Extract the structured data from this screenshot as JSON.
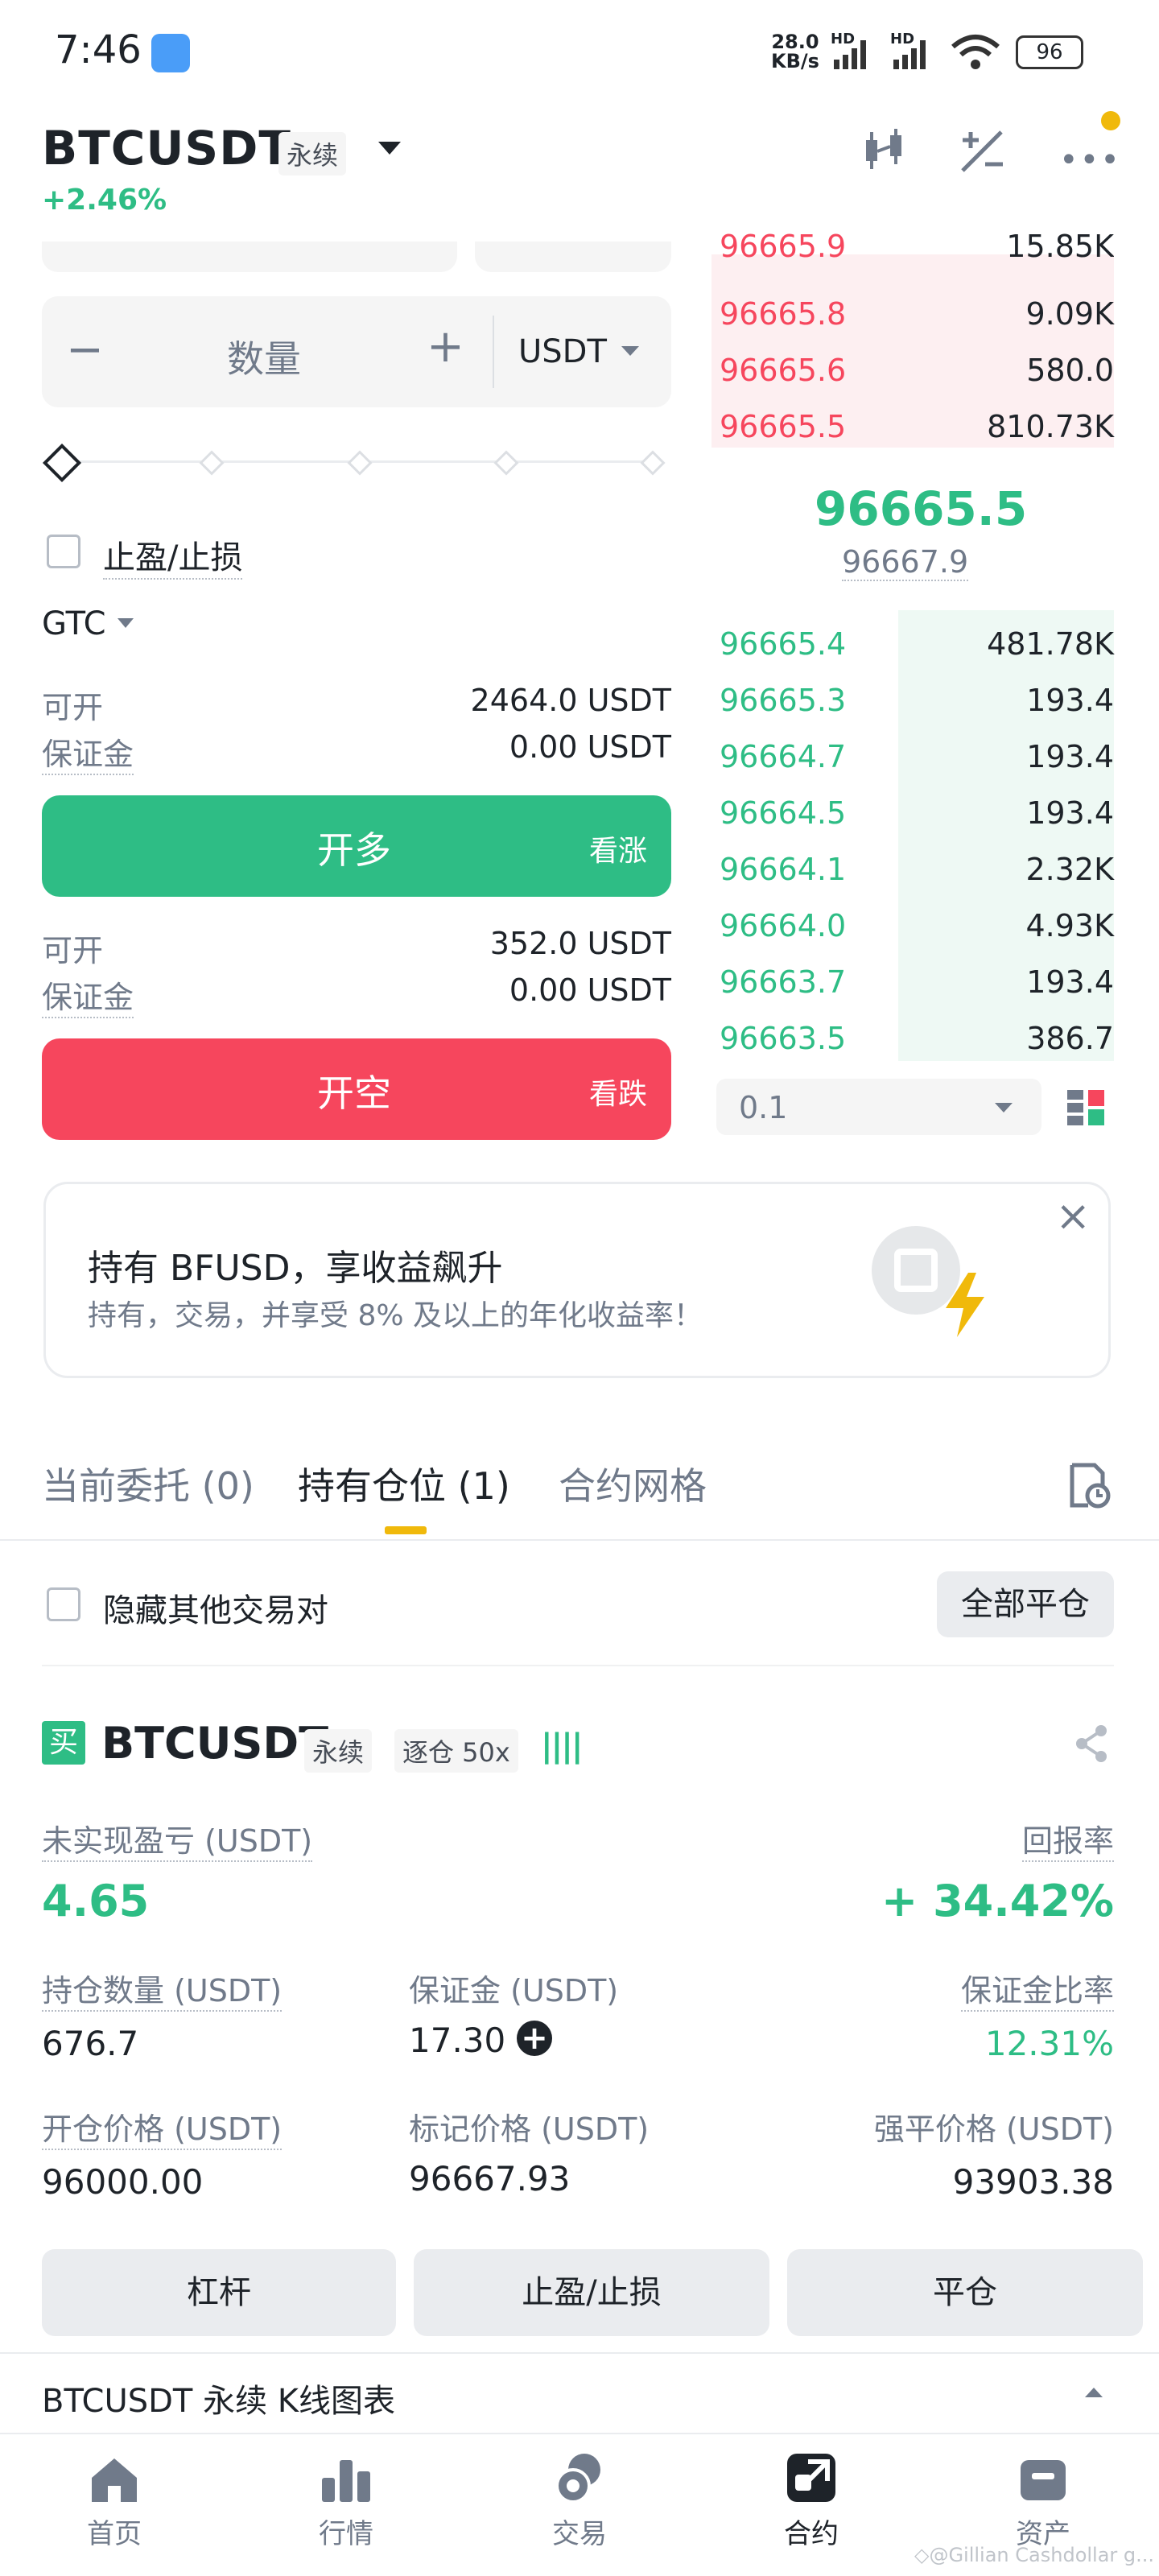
{
  "status_bar": {
    "time": "7:46",
    "net_speed_top": "28.0",
    "net_speed_bottom": "KB/s",
    "hd1": "HD",
    "hd2": "HD",
    "battery": "96"
  },
  "header": {
    "pair": "BTCUSDT",
    "contract_type": "永续",
    "change": "+2.46%"
  },
  "order_form": {
    "quantity_placeholder": "数量",
    "minus": "−",
    "plus": "+",
    "unit": "USDT",
    "tpsl_label": "止盈/止损",
    "time_in_force": "GTC",
    "long": {
      "available_label": "可开",
      "available_value": "2464.0 USDT",
      "margin_label": "保证金",
      "margin_value": "0.00 USDT",
      "button": "开多",
      "button_sub": "看涨"
    },
    "short": {
      "available_label": "可开",
      "available_value": "352.0 USDT",
      "margin_label": "保证金",
      "margin_value": "0.00 USDT",
      "button": "开空",
      "button_sub": "看跌"
    }
  },
  "orderbook": {
    "asks": [
      {
        "price": "96665.9",
        "qty": "15.85K"
      },
      {
        "price": "96665.8",
        "qty": "9.09K"
      },
      {
        "price": "96665.6",
        "qty": "580.0"
      },
      {
        "price": "96665.5",
        "qty": "810.73K"
      }
    ],
    "last_price": "96665.5",
    "mark_price": "96667.9",
    "bids": [
      {
        "price": "96665.4",
        "qty": "481.78K"
      },
      {
        "price": "96665.3",
        "qty": "193.4"
      },
      {
        "price": "96664.7",
        "qty": "193.4"
      },
      {
        "price": "96664.5",
        "qty": "193.4"
      },
      {
        "price": "96664.1",
        "qty": "2.32K"
      },
      {
        "price": "96664.0",
        "qty": "4.93K"
      },
      {
        "price": "96663.7",
        "qty": "193.4"
      },
      {
        "price": "96663.5",
        "qty": "386.7"
      }
    ],
    "precision": "0.1"
  },
  "banner": {
    "title": "持有 BFUSD，享收益飙升",
    "subtitle": "持有，交易，并享受 8% 及以上的年化收益率！"
  },
  "tabs": {
    "open_orders": "当前委托 (0)",
    "positions": "持有仓位 (1)",
    "grid": "合约网格"
  },
  "position_toolbar": {
    "hide_pairs": "隐藏其他交易对",
    "close_all": "全部平仓"
  },
  "position": {
    "side_badge": "买",
    "pair": "BTCUSDT",
    "type": "永续",
    "margin_mode": "逐仓 50x",
    "unrealized_label": "未实现盈亏 (USDT)",
    "unrealized_value": "4.65",
    "roe_label": "回报率",
    "roe_value": "+ 34.42%",
    "size_label": "持仓数量 (USDT)",
    "size_value": "676.7",
    "margin_label": "保证金 (USDT)",
    "margin_value": "17.30",
    "margin_ratio_label": "保证金比率",
    "margin_ratio_value": "12.31%",
    "entry_label": "开仓价格 (USDT)",
    "entry_value": "96000.00",
    "mark_label": "标记价格 (USDT)",
    "mark_value": "96667.93",
    "liq_label": "强平价格 (USDT)",
    "liq_value": "93903.38",
    "btn_leverage": "杠杆",
    "btn_tpsl": "止盈/止损",
    "btn_close": "平仓"
  },
  "chart_bar": {
    "label": "BTCUSDT 永续 K线图表"
  },
  "bottom_nav": [
    {
      "label": "首页",
      "icon": "home-icon"
    },
    {
      "label": "行情",
      "icon": "markets-icon"
    },
    {
      "label": "交易",
      "icon": "trade-icon"
    },
    {
      "label": "合约",
      "icon": "futures-icon"
    },
    {
      "label": "资产",
      "icon": "wallet-icon"
    }
  ],
  "watermark": "◇@Gillian Cashdollar g..."
}
